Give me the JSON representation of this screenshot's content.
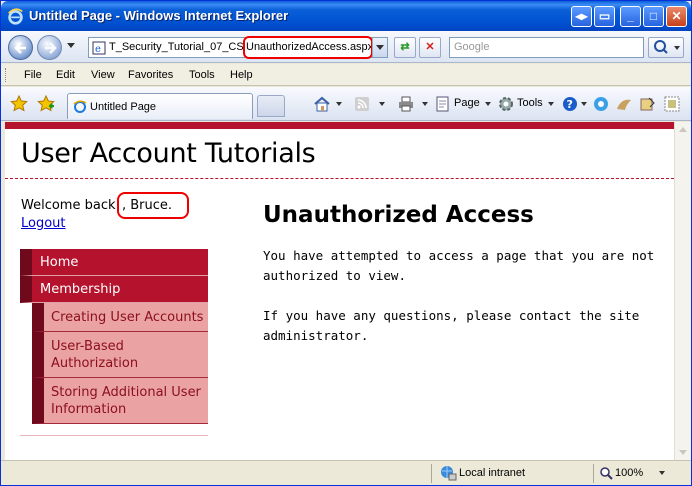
{
  "window": {
    "title": "Untitled Page - Windows Internet Explorer"
  },
  "address": {
    "url_prefix": "T_Security_Tutorial_07_CS",
    "url_highlight": "UnauthorizedAccess.aspx",
    "search_placeholder": "Google"
  },
  "menu": {
    "items": [
      "File",
      "Edit",
      "View",
      "Favorites",
      "Tools",
      "Help"
    ]
  },
  "tab": {
    "label": "Untitled Page"
  },
  "commands": {
    "page": "Page",
    "tools": "Tools"
  },
  "site": {
    "title": "User Account Tutorials",
    "welcome_prefix": "Welcome back",
    "welcome_name": ", Bruce.",
    "logout": "Logout"
  },
  "nav": {
    "top_items": [
      "Home",
      "Membership"
    ],
    "sub_items": [
      "Creating User Accounts",
      "User-Based Authorization",
      "Storing Additional User Information"
    ]
  },
  "main": {
    "heading": "Unauthorized Access",
    "paragraph1": "You have attempted to access a page that you are not authorized to view.",
    "paragraph2": "If you have any questions, please contact the site administrator."
  },
  "status": {
    "zone": "Local intranet",
    "zoom": "100%"
  }
}
